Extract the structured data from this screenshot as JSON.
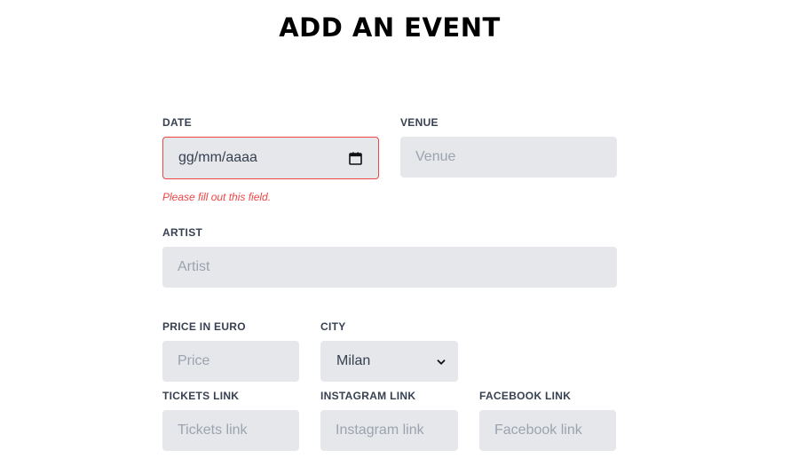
{
  "page": {
    "title": "ADD AN EVENT"
  },
  "form": {
    "date": {
      "label": "DATE",
      "value": "gg/mm/aaaa",
      "error": "Please fill out this field."
    },
    "venue": {
      "label": "VENUE",
      "placeholder": "Venue"
    },
    "artist": {
      "label": "ARTIST",
      "placeholder": "Artist"
    },
    "price": {
      "label": "PRICE IN EURO",
      "placeholder": "Price"
    },
    "city": {
      "label": "CITY",
      "selected": "Milan"
    },
    "tickets_link": {
      "label": "TICKETS LINK",
      "placeholder": "Tickets link"
    },
    "instagram_link": {
      "label": "INSTAGRAM LINK",
      "placeholder": "Instagram link"
    },
    "facebook_link": {
      "label": "FACEBOOK LINK",
      "placeholder": "Facebook link"
    }
  },
  "colors": {
    "field_bg": "#e5e7eb",
    "error": "#ef4444",
    "label": "#374151",
    "placeholder": "#9ca3af"
  },
  "icons": {
    "date": "calendar-icon",
    "select": "chevron-down-icon"
  }
}
